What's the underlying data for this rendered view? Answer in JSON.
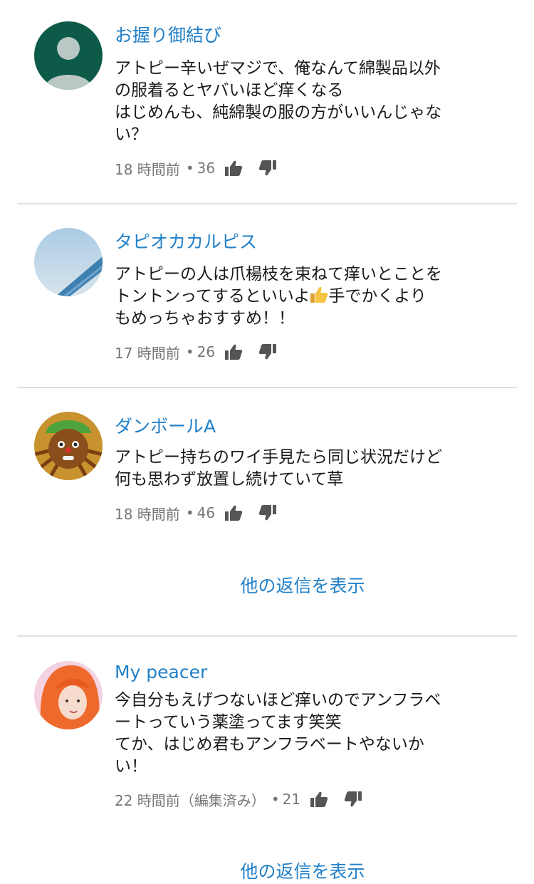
{
  "comments": [
    {
      "author": "お握り御結び",
      "text": "アトピー辛いぜマジで、俺なんて綿製品以外\nの服着るとヤバいほど痒くなる\nはじめんも、純綿製の服の方がいいんじゃな\nい？",
      "time": "18 時間前",
      "likes": "36",
      "avatar": "default-person-avatar"
    },
    {
      "author": "タピオカカルピス",
      "text_before": "アトピーの人は爪楊枝を束ねて痒いとことを\nトントンってするといいよ",
      "text_emoji": "thumbs-up-emoji",
      "text_after": "手でかくより\nもめっちゃおすすめ！！",
      "time": "17 時間前",
      "likes": "26",
      "avatar": "sky-photo-avatar"
    },
    {
      "author": "ダンボールA",
      "text": "アトピー持ちのワイ手見たら同じ状況だけど\n何も思わず放置し続けていて草",
      "time": "18 時間前",
      "likes": "46",
      "avatar": "cartoon-face-avatar"
    },
    {
      "author": "My peacer",
      "text": "今自分もえげつないほど痒いのでアンフラベ\nートっていう薬塗ってます笑笑\nてか、はじめ君もアンフラベートやないか\nい！",
      "time": "22 時間前（編集済み）",
      "likes": "21",
      "avatar": "orange-hair-person-avatar"
    }
  ],
  "more_replies_label": "他の返信を表示",
  "meta_separator": "•",
  "colors": {
    "link": "#2180c9",
    "text": "#1a1a1a",
    "meta": "#777777",
    "divider": "#e0e0e0",
    "icon": "#555555"
  }
}
